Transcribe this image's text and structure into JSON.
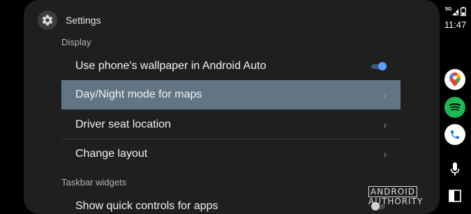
{
  "header": {
    "title": "Settings",
    "icon": "gear-icon"
  },
  "sections": {
    "display": "Display",
    "taskbar": "Taskbar widgets"
  },
  "rows": [
    {
      "label": "Use phone's wallpaper in Android Auto",
      "control": "toggle",
      "state": "on"
    },
    {
      "label": "Day/Night mode for maps",
      "control": "chevron",
      "highlighted": true
    },
    {
      "label": "Driver seat location",
      "control": "chevron"
    },
    {
      "label": "Change layout",
      "control": "chevron"
    },
    {
      "label": "Show quick controls for apps",
      "control": "toggle",
      "state": "off"
    }
  ],
  "chevron_glyph": "›",
  "status": {
    "network": "5G",
    "time": "11:47"
  },
  "rail_apps": [
    "google-maps-icon",
    "spotify-icon",
    "phone-icon",
    "microphone-icon",
    "taskbar-toggle-icon"
  ],
  "colors": {
    "panel": "#1f1f1f",
    "highlight": "#627585",
    "toggle_on": "#5aa0ff",
    "spotify": "#1db954",
    "phone": "#1a73e8"
  },
  "watermark": {
    "boxed": "ANDROID",
    "rest": "AUTHORITY"
  }
}
